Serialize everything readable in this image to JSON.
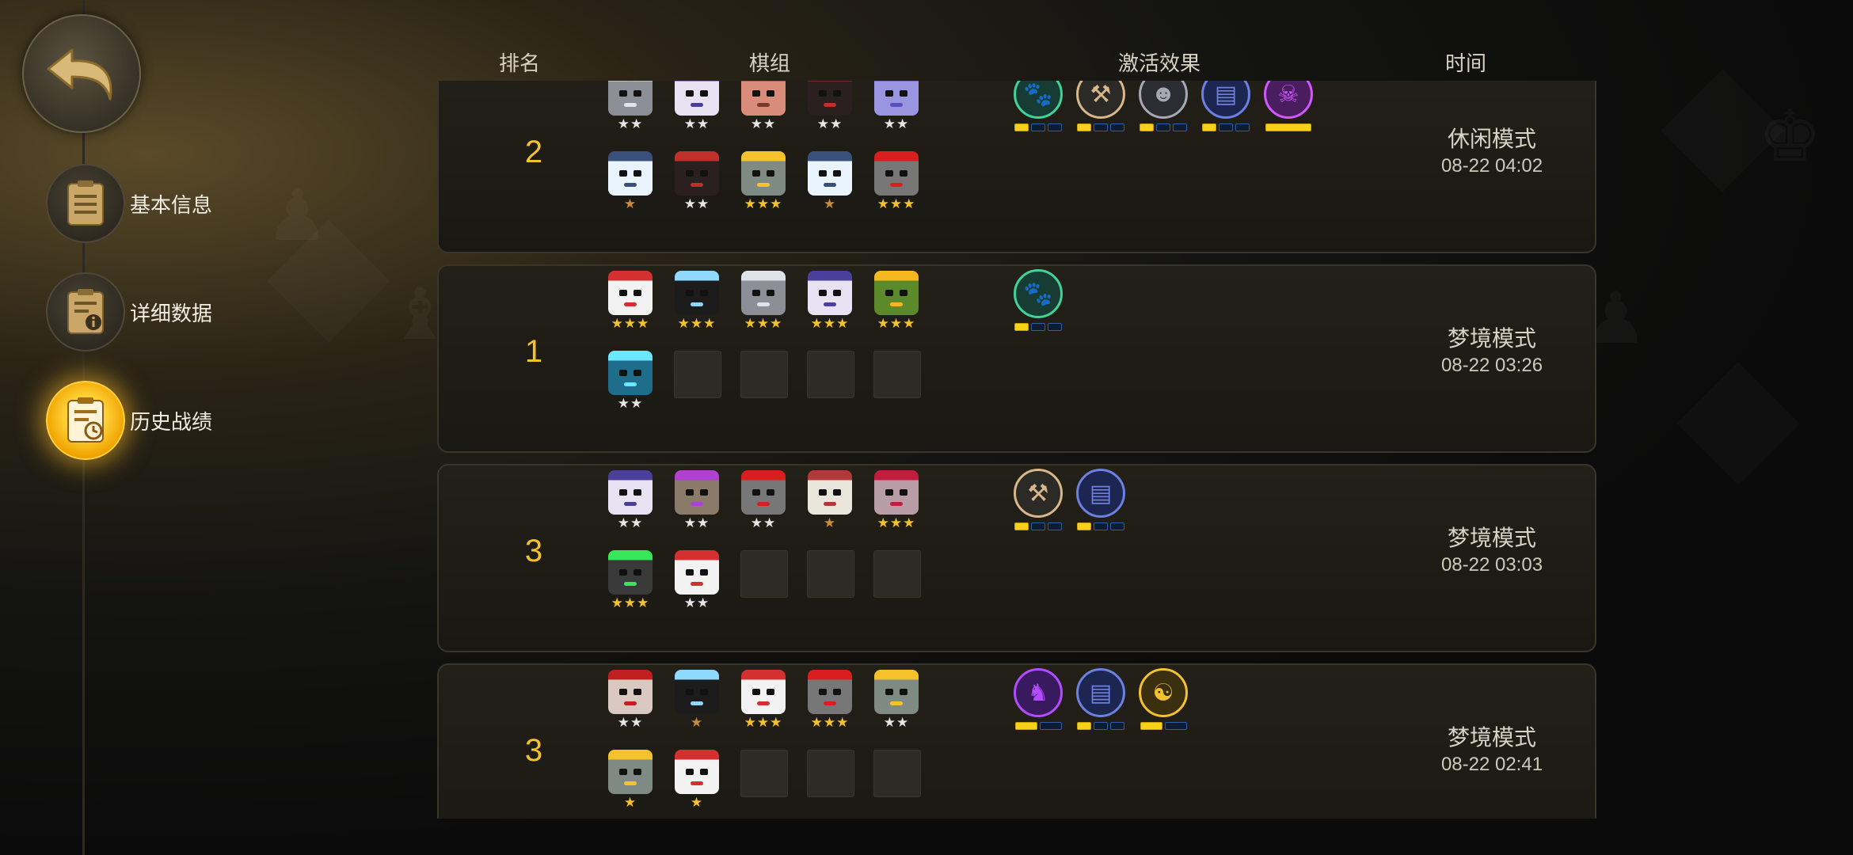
{
  "nav": {
    "items": [
      {
        "label": "基本信息",
        "icon": "clipboard-icon",
        "active": false
      },
      {
        "label": "详细数据",
        "icon": "clipboard-info-icon",
        "active": false
      },
      {
        "label": "历史战绩",
        "icon": "clipboard-history-icon",
        "active": true
      }
    ]
  },
  "headers": {
    "rank": "排名",
    "lineup": "棋组",
    "effects": "激活效果",
    "time": "时间"
  },
  "colors": {
    "accent": "#f5c22b",
    "star_gold": "#f5c22b",
    "star_silver": "#e6e6e6",
    "star_bronze": "#c98b3c"
  },
  "records": [
    {
      "rank": "2",
      "mode": "休闲模式",
      "time": "08-22 04:02",
      "pieces": [
        {
          "stars": "★★",
          "tier": "silver",
          "color": "#8c8f96",
          "accent": "#dfe3ea"
        },
        {
          "stars": "★★",
          "tier": "silver",
          "color": "#e9e2f2",
          "accent": "#4a3f9a"
        },
        {
          "stars": "★★",
          "tier": "silver",
          "color": "#d98c7a",
          "accent": "#7a3a2a"
        },
        {
          "stars": "★★",
          "tier": "silver",
          "color": "#2a2020",
          "accent": "#c0302a"
        },
        {
          "stars": "★★",
          "tier": "silver",
          "color": "#9a95e0",
          "accent": "#5b4fc0"
        },
        {
          "stars": "★",
          "tier": "bronze",
          "color": "#eaf4ff",
          "accent": "#3a4f7a"
        },
        {
          "stars": "★★",
          "tier": "silver",
          "color": "#2a2020",
          "accent": "#c0302a"
        },
        {
          "stars": "★★★",
          "tier": "gold",
          "color": "#7f8a84",
          "accent": "#f5c22b"
        },
        {
          "stars": "★",
          "tier": "bronze",
          "color": "#eaf4ff",
          "accent": "#3a4f7a"
        },
        {
          "stars": "★★★",
          "tier": "gold",
          "color": "#777777",
          "accent": "#d81e1e"
        }
      ],
      "empty_slots": 0,
      "effects": [
        {
          "icon": "paw-icon",
          "bg": "#173c34",
          "fg": "#3fd39a",
          "levels": 3,
          "active": 1
        },
        {
          "icon": "axe-icon",
          "bg": "#2c2a27",
          "fg": "#d8b88a",
          "levels": 3,
          "active": 1
        },
        {
          "icon": "bust-icon",
          "bg": "#2c2d33",
          "fg": "#a6a9b4",
          "levels": 3,
          "active": 1
        },
        {
          "icon": "book-icon",
          "bg": "#1d2650",
          "fg": "#6c80e0",
          "levels": 3,
          "active": 1
        },
        {
          "icon": "demon-icon",
          "bg": "#4a1d5e",
          "fg": "#d157ff",
          "levels": 1,
          "active": 1
        }
      ]
    },
    {
      "rank": "1",
      "mode": "梦境模式",
      "time": "08-22 03:26",
      "pieces": [
        {
          "stars": "★★★",
          "tier": "gold",
          "color": "#f2f2f2",
          "accent": "#d43030"
        },
        {
          "stars": "★★★",
          "tier": "gold",
          "color": "#1c1c1c",
          "accent": "#8fd8ff"
        },
        {
          "stars": "★★★",
          "tier": "gold",
          "color": "#8c8f96",
          "accent": "#dfe3ea"
        },
        {
          "stars": "★★★",
          "tier": "gold",
          "color": "#e9e2f2",
          "accent": "#4a3f9a"
        },
        {
          "stars": "★★★",
          "tier": "gold",
          "color": "#5c8a2a",
          "accent": "#f5b820"
        },
        {
          "stars": "★★",
          "tier": "silver",
          "color": "#1e6d8a",
          "accent": "#6ae8ff"
        }
      ],
      "empty_slots": 4,
      "effects": [
        {
          "icon": "paw-icon",
          "bg": "#173c34",
          "fg": "#3fd39a",
          "levels": 3,
          "active": 1
        }
      ]
    },
    {
      "rank": "3",
      "mode": "梦境模式",
      "time": "08-22 03:03",
      "pieces": [
        {
          "stars": "★★",
          "tier": "silver",
          "color": "#e9e2f2",
          "accent": "#4a3f9a"
        },
        {
          "stars": "★★",
          "tier": "silver",
          "color": "#8a7a6a",
          "accent": "#b040d0"
        },
        {
          "stars": "★★",
          "tier": "silver",
          "color": "#777777",
          "accent": "#d81e1e"
        },
        {
          "stars": "★",
          "tier": "bronze",
          "color": "#eae6dc",
          "accent": "#b03a3a"
        },
        {
          "stars": "★★★",
          "tier": "gold",
          "color": "#b89ca6",
          "accent": "#c01e3c"
        },
        {
          "stars": "★★★",
          "tier": "gold",
          "color": "#3a3a3a",
          "accent": "#39e65a"
        },
        {
          "stars": "★★",
          "tier": "silver",
          "color": "#f2f2f2",
          "accent": "#d43030"
        }
      ],
      "empty_slots": 3,
      "effects": [
        {
          "icon": "axe-icon",
          "bg": "#2c2a27",
          "fg": "#d8b88a",
          "levels": 3,
          "active": 1
        },
        {
          "icon": "book-icon",
          "bg": "#1d2650",
          "fg": "#6c80e0",
          "levels": 3,
          "active": 1
        }
      ]
    },
    {
      "rank": "3",
      "mode": "梦境模式",
      "time": "08-22 02:41",
      "pieces": [
        {
          "stars": "★★",
          "tier": "silver",
          "color": "#d8c8c0",
          "accent": "#c02020"
        },
        {
          "stars": "★",
          "tier": "bronze",
          "color": "#1c1c1c",
          "accent": "#8fd8ff"
        },
        {
          "stars": "★★★",
          "tier": "gold",
          "color": "#f2f2f2",
          "accent": "#d43030"
        },
        {
          "stars": "★★★",
          "tier": "gold",
          "color": "#777777",
          "accent": "#d81e1e"
        },
        {
          "stars": "★★",
          "tier": "silver",
          "color": "#7f8a84",
          "accent": "#f5c22b"
        },
        {
          "stars": "★",
          "tier": "gold",
          "color": "#7f8a84",
          "accent": "#f5c22b"
        },
        {
          "stars": "★",
          "tier": "gold",
          "color": "#f2f2f2",
          "accent": "#d43030"
        }
      ],
      "empty_slots": 3,
      "effects": [
        {
          "icon": "hooded-icon",
          "bg": "#3a1a5e",
          "fg": "#b24cff",
          "levels": 2,
          "active": 1
        },
        {
          "icon": "book-icon",
          "bg": "#1d2650",
          "fg": "#6c80e0",
          "levels": 3,
          "active": 1
        },
        {
          "icon": "emblem-icon",
          "bg": "#3a3010",
          "fg": "#f2c12e",
          "levels": 2,
          "active": 1
        }
      ]
    }
  ]
}
